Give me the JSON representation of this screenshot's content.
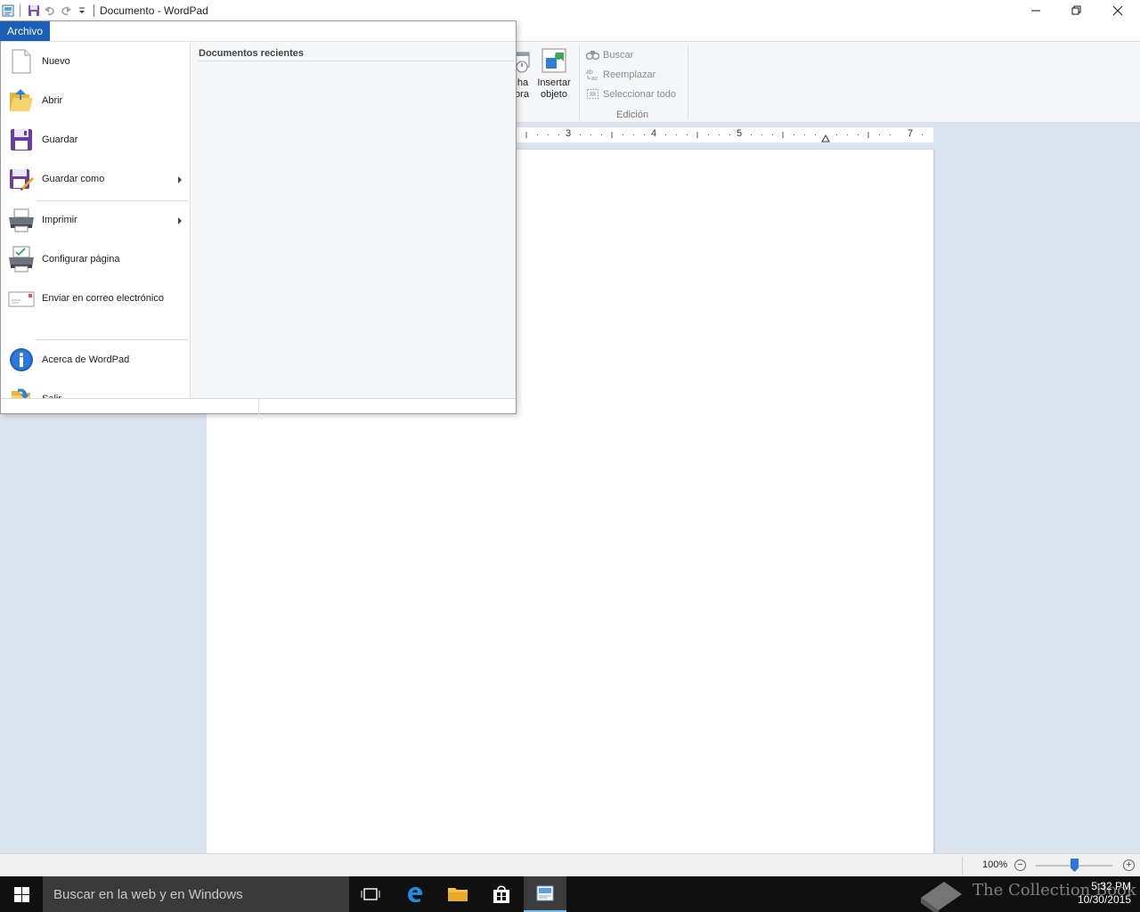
{
  "window": {
    "title": "Documento - WordPad",
    "controls": {
      "minimize": "minimize-icon",
      "restore": "restore-icon",
      "close": "close-icon"
    }
  },
  "quick_access": [
    "save-icon",
    "undo-icon",
    "redo-icon",
    "customize-dropdown-icon"
  ],
  "file_menu": {
    "tab_label": "Archivo",
    "recent_title": "Documentos recientes",
    "items": [
      {
        "label": "Nuevo",
        "icon": "new-document-icon",
        "submenu": false
      },
      {
        "label": "Abrir",
        "icon": "open-folder-icon",
        "submenu": false
      },
      {
        "label": "Guardar",
        "icon": "floppy-save-icon",
        "submenu": false
      },
      {
        "label": "Guardar como",
        "icon": "save-as-icon",
        "submenu": true
      },
      {
        "label": "Imprimir",
        "icon": "printer-icon",
        "submenu": true
      },
      {
        "label": "Configurar página",
        "icon": "page-setup-icon",
        "submenu": false
      },
      {
        "label": "Enviar en correo electrónico",
        "icon": "email-icon",
        "submenu": false
      },
      {
        "label": "Acerca de WordPad",
        "icon": "info-icon",
        "submenu": false
      },
      {
        "label": "Salir",
        "icon": "exit-icon",
        "submenu": false
      }
    ]
  },
  "ribbon": {
    "partial_button_line1": "ha",
    "partial_button_line2": "ora",
    "insert_object_line1": "Insertar",
    "insert_object_line2": "objeto",
    "editing": {
      "find": "Buscar",
      "replace": "Reemplazar",
      "select_all": "Seleccionar todo",
      "group_label": "Edición"
    }
  },
  "ruler": {
    "numbers": [
      "3",
      "4",
      "5",
      "7"
    ]
  },
  "statusbar": {
    "zoom": "100%",
    "zoom_level_percent": 100
  },
  "taskbar": {
    "search_placeholder": "Buscar en la web y en Windows",
    "time": "5:32 PM",
    "date": "10/30/2015",
    "watermark": "The Collection Book"
  }
}
